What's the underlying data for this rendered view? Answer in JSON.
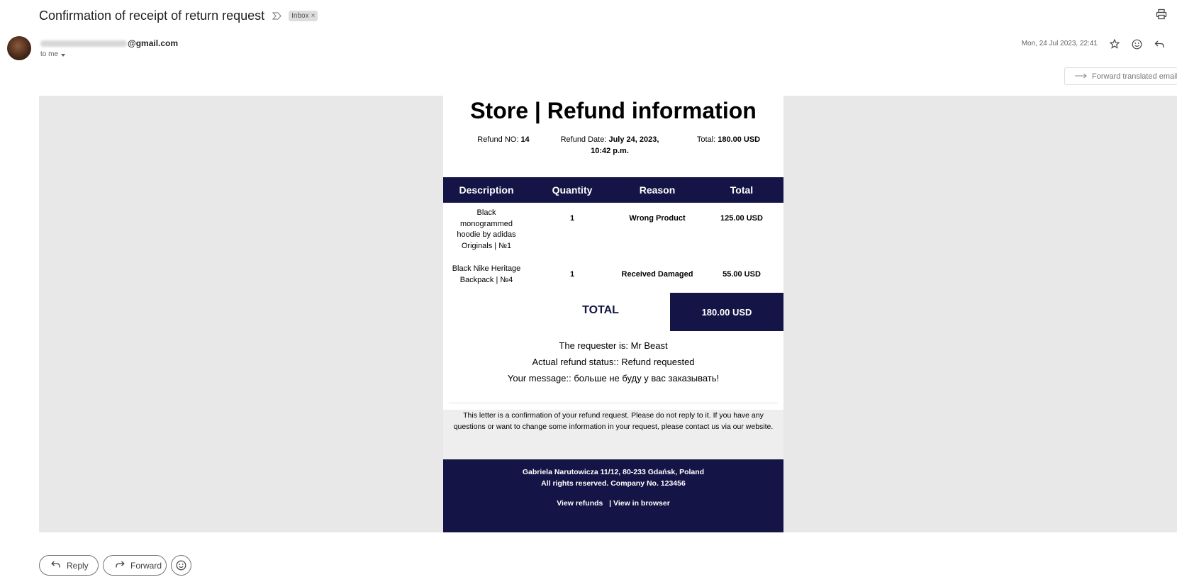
{
  "header": {
    "subject": "Confirmation of receipt of return request",
    "label": "Inbox",
    "label_close": "×",
    "sender_visible": "@gmail.com",
    "to": "to me",
    "date": "Mon, 24 Jul 2023, 22:41",
    "forward_translated": "Forward translated email"
  },
  "email": {
    "title": "Store | Refund information",
    "refund_no_label": "Refund NO: ",
    "refund_no": "14",
    "refund_date_label": "Refund Date: ",
    "refund_date_line1": "July 24, 2023,",
    "refund_date_line2": "10:42 p.m.",
    "total_label": "Total: ",
    "total_value": "180.00 USD",
    "columns": [
      "Description",
      "Quantity",
      "Reason",
      "Total"
    ],
    "rows": [
      {
        "description_lines": [
          "Black",
          "monogrammed",
          "hoodie by adidas",
          "Originals | №1"
        ],
        "quantity": "1",
        "reason": "Wrong Product",
        "total": "125.00 USD"
      },
      {
        "description_lines": [
          "Black Nike Heritage",
          "Backpack | №4"
        ],
        "quantity": "1",
        "reason": "Received Damaged",
        "total": "55.00 USD"
      }
    ],
    "grand_total_label": "TOTAL",
    "grand_total_value": "180.00 USD",
    "requester": "The requester is: Mr Beast",
    "status": "Actual refund status:: Refund requested",
    "message": "Your message:: больше не буду у вас заказывать!",
    "notice": "This letter is a confirmation of your refund request. Please do not reply to it. If you have any questions or want to change some information in your request, please contact us via our website.",
    "address_line1": "Gabriela Narutowicza 11/12, 80-233 Gdańsk, Poland",
    "address_line2": "All rights reserved.  Company No. 123456",
    "link_refunds": "View refunds",
    "link_sep": "|",
    "link_browser": "View in browser"
  },
  "actions": {
    "reply": "Reply",
    "forward": "Forward"
  },
  "colors": {
    "navy": "#141446",
    "gray_bg": "#e8e8e8"
  }
}
